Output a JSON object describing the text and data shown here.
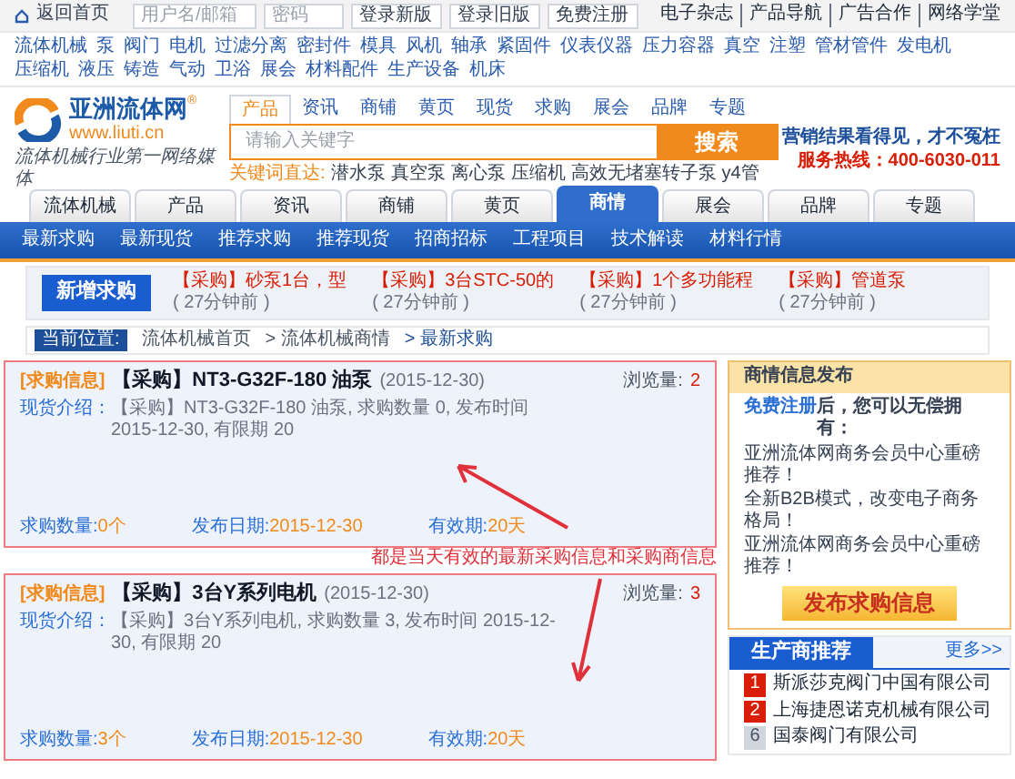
{
  "top_bar": {
    "home_link": "返回首页",
    "username_placeholder": "用户名/邮箱",
    "password_placeholder": "密码",
    "buttons": [
      "登录新版",
      "登录旧版",
      "免费注册"
    ],
    "links": [
      "电子杂志",
      "产品导航",
      "广告合作",
      "网络学堂"
    ]
  },
  "category_nav": [
    "流体机械",
    "泵",
    "阀门",
    "电机",
    "过滤分离",
    "密封件",
    "模具",
    "风机",
    "轴承",
    "紧固件",
    "仪表仪器",
    "压力容器",
    "真空",
    "注塑",
    "管材管件",
    "发电机",
    "压缩机",
    "液压",
    "铸造",
    "气动",
    "卫浴",
    "展会",
    "材料配件",
    "生产设备",
    "机床"
  ],
  "logo": {
    "name": "亚洲流体网",
    "url": "www.liuti.cn",
    "registered": "®",
    "slogan": "流体机械行业第一网络媒体"
  },
  "search": {
    "tabs": [
      {
        "label": "产品",
        "selected": true
      },
      {
        "label": "资讯",
        "selected": false
      },
      {
        "label": "商铺",
        "selected": false
      },
      {
        "label": "黄页",
        "selected": false
      },
      {
        "label": "现货",
        "selected": false
      },
      {
        "label": "求购",
        "selected": false
      },
      {
        "label": "展会",
        "selected": false
      },
      {
        "label": "品牌",
        "selected": false
      },
      {
        "label": "专题",
        "selected": false
      }
    ],
    "placeholder": "请输入关键字",
    "button": "搜索",
    "hot_label": "关键词直达:",
    "hot_words": [
      "潜水泵",
      "真空泵",
      "离心泵",
      "压缩机",
      "高效无堵塞转子泵",
      "y4管"
    ]
  },
  "promo": {
    "slogan": "营销结果看得见，才不冤枉",
    "hotline": "服务热线：400-6030-011"
  },
  "main_nav": [
    {
      "label": "流体机械",
      "selected": false
    },
    {
      "label": "产品",
      "selected": false
    },
    {
      "label": "资讯",
      "selected": false
    },
    {
      "label": "商铺",
      "selected": false
    },
    {
      "label": "黄页",
      "selected": false
    },
    {
      "label": "商情",
      "selected": true
    },
    {
      "label": "展会",
      "selected": false
    },
    {
      "label": "品牌",
      "selected": false
    },
    {
      "label": "专题",
      "selected": false
    }
  ],
  "sub_nav": [
    "最新求购",
    "最新现货",
    "推荐求购",
    "推荐现货",
    "招商招标",
    "工程项目",
    "技术解读",
    "材料行情"
  ],
  "ticker": {
    "label": "新增求购",
    "items": [
      {
        "title": "【采购】砂泵1台，型",
        "time": "( 27分钟前 )"
      },
      {
        "title": "【采购】3台STC-50的",
        "time": "( 27分钟前 )"
      },
      {
        "title": "【采购】1个多功能程",
        "time": "( 27分钟前 )"
      },
      {
        "title": "【采购】管道泵",
        "time": "( 27分钟前 )"
      }
    ]
  },
  "breadcrumb": {
    "label": "当前位置:",
    "items": [
      "流体机械首页",
      "> 流体机械商情",
      "> 最新求购"
    ]
  },
  "listings": [
    {
      "tag": "[求购信息]",
      "title": "【采购】NT3-G32F-180 油泵",
      "date": "(2015-12-30)",
      "desc_label": "现货介绍：",
      "desc": "【采购】NT3-G32F-180 油泵, 求购数量 0, 发布时间 2015-12-30, 有限期 20",
      "views_label": "浏览量:",
      "views": "2",
      "qty_label": "求购数量:",
      "qty": "0个",
      "pub_label": "发布日期:",
      "pub": "2015-12-30",
      "valid_label": "有效期:",
      "valid": "20天"
    },
    {
      "tag": "[求购信息]",
      "title": "【采购】3台Y系列电机",
      "date": "(2015-12-30)",
      "desc_label": "现货介绍：",
      "desc": "【采购】3台Y系列电机, 求购数量 3, 发布时间 2015-12-30, 有限期 20",
      "views_label": "浏览量:",
      "views": "3",
      "qty_label": "求购数量:",
      "qty": "3个",
      "pub_label": "发布日期:",
      "pub": "2015-12-30",
      "valid_label": "有效期:",
      "valid": "20天"
    }
  ],
  "annotation": "都是当天有效的最新采购信息和采购商信息",
  "publish_box": {
    "title": "商情信息发布",
    "register_link": "免费注册",
    "register_text": "后，您可以无偿拥有：",
    "lines": [
      "亚洲流体网商务会员中心重磅推荐！",
      "全新B2B模式，改变电子商务格局！",
      "亚洲流体网商务会员中心重磅推荐！"
    ],
    "button": "发布求购信息"
  },
  "recommend": {
    "title": "生产商推荐",
    "more": "更多>>",
    "items": [
      {
        "rank": "1",
        "name": "斯派莎克阀门中国有限公司",
        "highlighted": true
      },
      {
        "rank": "2",
        "name": "上海捷恩诺克机械有限公司",
        "highlighted": true
      },
      {
        "rank": "6",
        "name": "国泰阀门有限公司",
        "highlighted": false
      }
    ]
  }
}
